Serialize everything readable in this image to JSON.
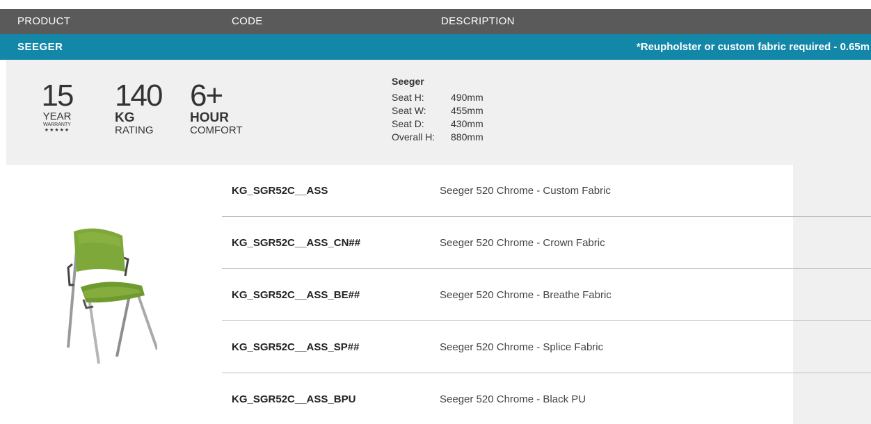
{
  "header": {
    "col_product": "PRODUCT",
    "col_code": "CODE",
    "col_description": "DESCRIPTION"
  },
  "section": {
    "name": "SEEGER",
    "note": "*Reupholster or custom fabric required - 0.65m"
  },
  "badges": {
    "warranty": {
      "number": "15",
      "label": "YEAR",
      "sub": "WARRANTY",
      "stars": "★★★★★"
    },
    "weight": {
      "number": "140",
      "unit": "KG",
      "label": "RATING"
    },
    "comfort": {
      "number": "6+",
      "unit": "HOUR",
      "label": "COMFORT"
    }
  },
  "specs": {
    "title": "Seeger",
    "rows": [
      {
        "label": "Seat H:",
        "value": "490mm"
      },
      {
        "label": "Seat W:",
        "value": "455mm"
      },
      {
        "label": "Seat D:",
        "value": "430mm"
      },
      {
        "label": "Overall H:",
        "value": "880mm"
      }
    ]
  },
  "products": [
    {
      "code": "KG_SGR52C__ASS",
      "description": "Seeger 520 Chrome - Custom Fabric"
    },
    {
      "code": "KG_SGR52C__ASS_CN##",
      "description": "Seeger 520 Chrome - Crown Fabric"
    },
    {
      "code": "KG_SGR52C__ASS_BE##",
      "description": "Seeger 520 Chrome - Breathe Fabric"
    },
    {
      "code": "KG_SGR52C__ASS_SP##",
      "description": "Seeger 520 Chrome - Splice Fabric"
    },
    {
      "code": "KG_SGR52C__ASS_BPU",
      "description": "Seeger 520 Chrome - Black PU"
    }
  ],
  "colors": {
    "header": "#5a5a5a",
    "band": "#1387a8",
    "panel": "#f0f0f0",
    "fabric": "#7fa83a"
  }
}
